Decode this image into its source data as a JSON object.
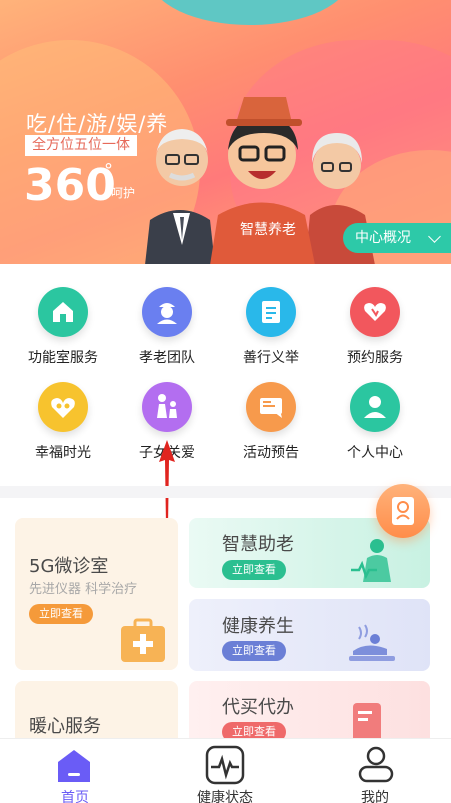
{
  "banner": {
    "line1": "吃/住/游/娱/养",
    "line2": "全方位五位一体",
    "number": "360",
    "degree": "°",
    "sub": "呵护",
    "shirt_text": "智慧养老",
    "overview_button": "中心概况"
  },
  "services": [
    {
      "label": "功能室服务",
      "icon": "home-icon",
      "color": "#2bc6a0"
    },
    {
      "label": "孝老团队",
      "icon": "nurse-icon",
      "color": "#6a7ff0"
    },
    {
      "label": "善行义举",
      "icon": "document-icon",
      "color": "#29b8ea"
    },
    {
      "label": "预约服务",
      "icon": "heart-hands-icon",
      "color": "#f2575d"
    },
    {
      "label": "幸福时光",
      "icon": "heart-people-icon",
      "color": "#f7c32e"
    },
    {
      "label": "子女关爱",
      "icon": "parent-child-icon",
      "color": "#b36ef0"
    },
    {
      "label": "活动预告",
      "icon": "notice-icon",
      "color": "#f79a4c"
    },
    {
      "label": "个人中心",
      "icon": "person-icon",
      "color": "#2bc6a0"
    }
  ],
  "cards": {
    "clinic": {
      "title": "5G微诊室",
      "subtitle": "先进仪器  科学治疗",
      "button": "立即查看",
      "button_color": "#f59a3a"
    },
    "smart": {
      "title": "智慧助老",
      "button": "立即查看",
      "button_color": "#2bbf90"
    },
    "health": {
      "title": "健康养生",
      "button": "立即查看",
      "button_color": "#6b7fd6"
    },
    "warm": {
      "title": "暖心服务"
    },
    "errand": {
      "title": "代买代办",
      "button": "立即查看",
      "button_color": "#ef6a6a"
    }
  },
  "tabs": [
    {
      "label": "首页",
      "icon": "home-tab-icon",
      "active": true
    },
    {
      "label": "健康状态",
      "icon": "heartbeat-icon",
      "active": false
    },
    {
      "label": "我的",
      "icon": "profile-icon",
      "active": false
    }
  ]
}
